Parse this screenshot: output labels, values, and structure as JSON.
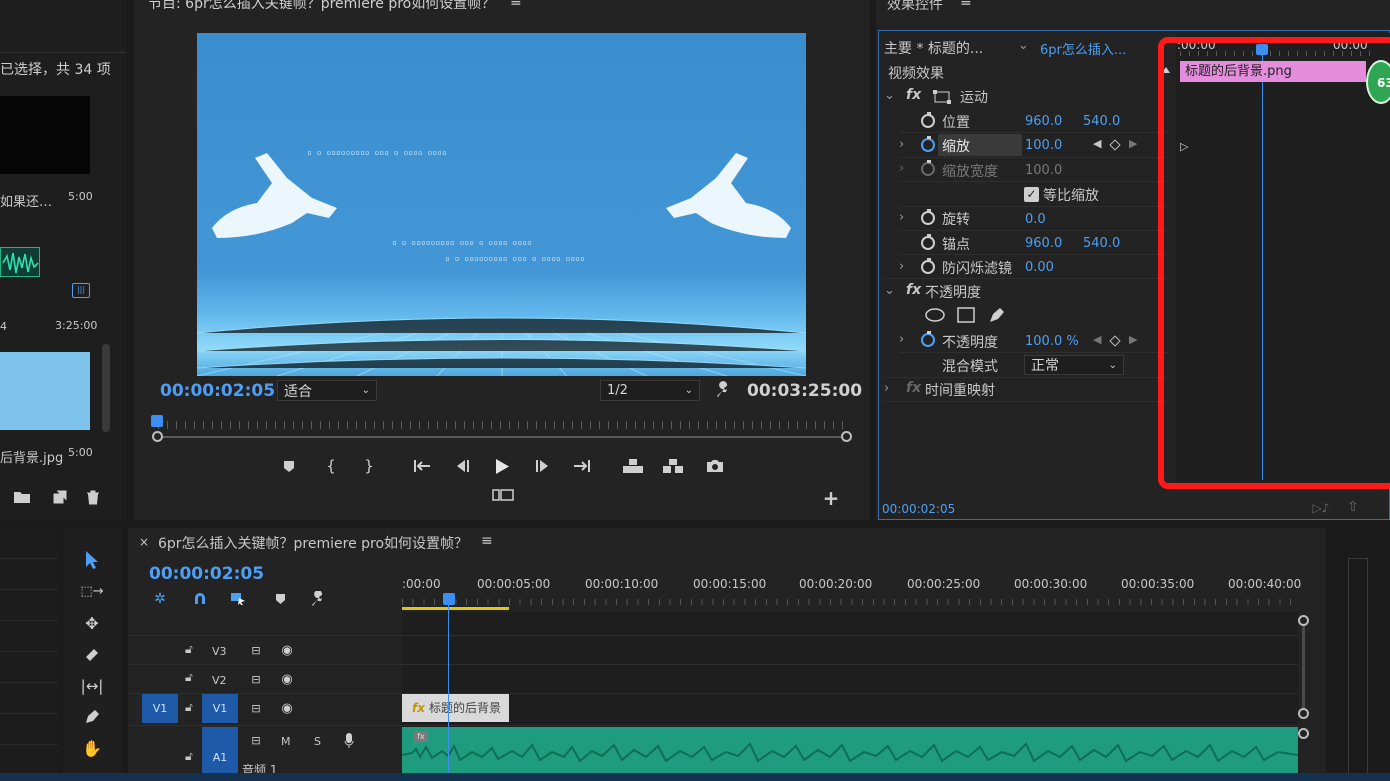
{
  "project_panel": {
    "selection_text": "已选择，共 34 项",
    "items": [
      {
        "name": "如果还…",
        "duration": "5:00"
      },
      {
        "name": "",
        "duration": "3:25:00",
        "index": "4"
      },
      {
        "name": "后背景.jpg",
        "duration": "5:00"
      }
    ]
  },
  "program_monitor": {
    "title": "节目: 6pr怎么插入关键帧？premiere pro如何设置帧？",
    "timecode": "00:00:02:05",
    "fit_label": "适合",
    "resolution": "1/2",
    "duration": "00:03:25:00"
  },
  "effect_controls": {
    "title": "效果控件",
    "source_label": "主要 * 标题的...",
    "sequence_label": "6pr怎么插入...",
    "clip_name": "标题的后背景.png",
    "ruler_start": ":00:00",
    "ruler_end": "00:00",
    "section_video": "视频效果",
    "motion": "运动",
    "position_label": "位置",
    "position_x": "960.0",
    "position_y": "540.0",
    "scale_label": "缩放",
    "scale_value": "100.0",
    "scale_width_label": "缩放宽度",
    "scale_width_value": "100.0",
    "uniform_scale": "等比缩放",
    "rotation_label": "旋转",
    "rotation_value": "0.0",
    "anchor_label": "锚点",
    "anchor_x": "960.0",
    "anchor_y": "540.0",
    "antiflicker_label": "防闪烁滤镜",
    "antiflicker_value": "0.00",
    "opacity_section": "不透明度",
    "opacity_label": "不透明度",
    "opacity_value": "100.0 %",
    "blend_label": "混合模式",
    "blend_value": "正常",
    "time_remap": "时间重映射",
    "footer_timecode": "00:00:02:05",
    "badge": "63"
  },
  "timeline": {
    "title": "6pr怎么插入关键帧？premiere pro如何设置帧？",
    "timecode": "00:00:02:05",
    "ruler_labels": [
      ":00:00",
      "00:00:05:00",
      "00:00:10:00",
      "00:00:15:00",
      "00:00:20:00",
      "00:00:25:00",
      "00:00:30:00",
      "00:00:35:00",
      "00:00:40:00"
    ],
    "tracks": {
      "v3": "V3",
      "v2": "V2",
      "v1": "V1",
      "v1_src": "V1",
      "a1": "A1",
      "m": "M",
      "s": "S",
      "audio_name": "音频 1"
    },
    "clip_label": "标题的后背景"
  },
  "colors": {
    "accent": "#4d9ff5",
    "highlight": "#ff1a1a",
    "clip_pink": "#e58ddd",
    "audio_green": "#1f9c7e",
    "video_bg": "#3d8fd1"
  }
}
